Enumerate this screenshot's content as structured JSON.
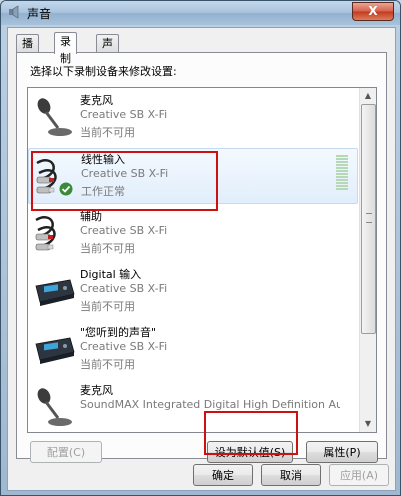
{
  "window": {
    "title": "声音",
    "close_label": "X"
  },
  "tabs": [
    {
      "label": "播放",
      "active": false
    },
    {
      "label": "录制",
      "active": true
    },
    {
      "label": "声音",
      "active": false
    }
  ],
  "instruction": "选择以下录制设备来修改设置:",
  "devices": [
    {
      "name": "麦克风",
      "driver": "Creative SB X-Fi",
      "status": "当前不可用",
      "icon": "microphone-icon"
    },
    {
      "name": "线性输入",
      "driver": "Creative SB X-Fi",
      "status": "工作正常",
      "icon": "rca-cable-icon",
      "selected": true,
      "default": true
    },
    {
      "name": "辅助",
      "driver": "Creative SB X-Fi",
      "status": "当前不可用",
      "icon": "rca-cable-icon"
    },
    {
      "name": "Digital 输入",
      "driver": "Creative SB X-Fi",
      "status": "当前不可用",
      "icon": "digital-device-icon"
    },
    {
      "name": "\"您听到的声音\"",
      "driver": "Creative SB X-Fi",
      "status": "当前不可用",
      "icon": "digital-device-icon"
    },
    {
      "name": "麦克风",
      "driver": "SoundMAX Integrated Digital High Definition Audio",
      "status": "",
      "icon": "microphone-icon"
    }
  ],
  "buttons": {
    "configure": "配置(C)",
    "set_default": "设为默认值(S)",
    "properties": "属性(P)",
    "ok": "确定",
    "cancel": "取消",
    "apply": "应用(A)"
  },
  "colors": {
    "highlight": "#cc1111",
    "accent": "#3a8a3a"
  }
}
